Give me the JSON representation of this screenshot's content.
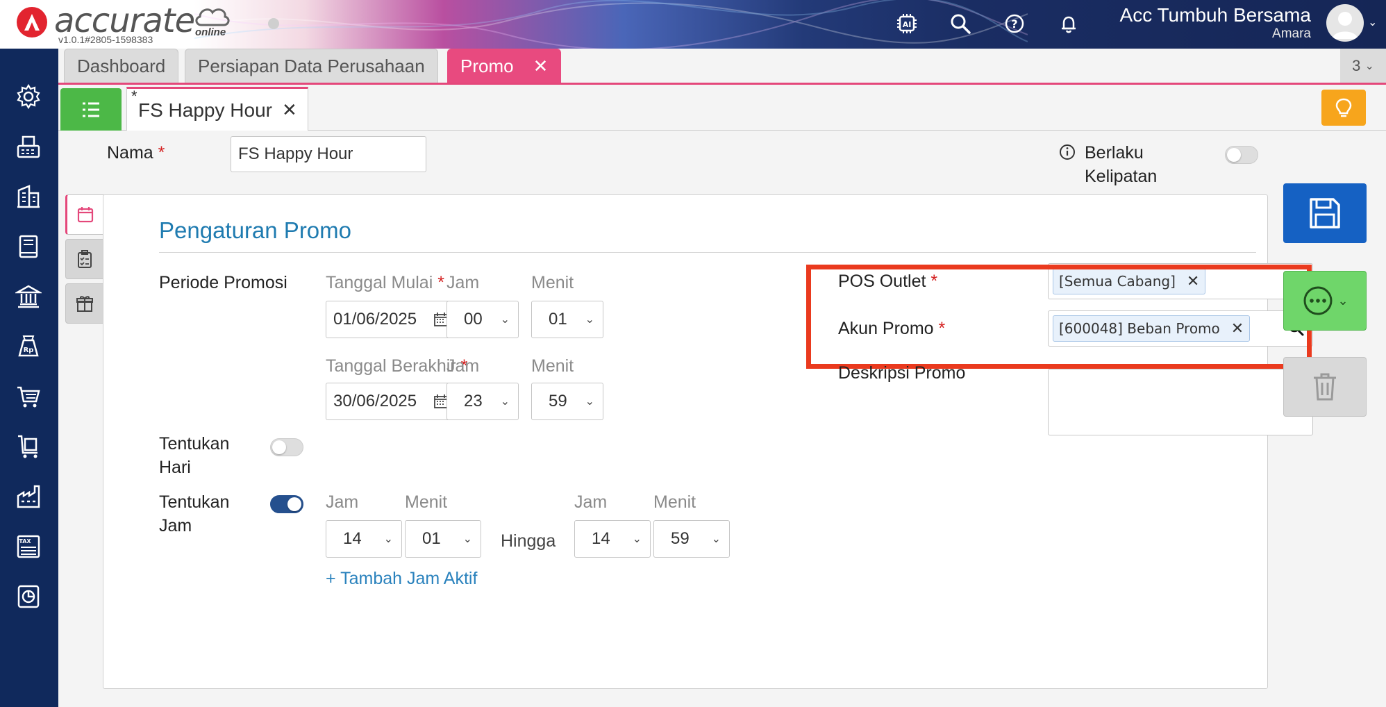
{
  "header": {
    "brand": "accurate",
    "brand_sub": "online",
    "version": "v1.0.1#2805-1598383",
    "company": "Acc Tumbuh Bersama",
    "user": "Amara"
  },
  "tabs": [
    {
      "label": "Dashboard"
    },
    {
      "label": "Persiapan Data Perusahaan"
    },
    {
      "label": "Promo"
    }
  ],
  "tab_count": "3",
  "doc_tab": {
    "modified": "*",
    "label": "FS Happy Hour"
  },
  "form": {
    "nama_label": "Nama",
    "nama_value": "FS Happy Hour",
    "kelipatan_label_1": "Berlaku",
    "kelipatan_label_2": "Kelipatan"
  },
  "panel": {
    "title": "Pengaturan Promo",
    "periode_label": "Periode Promosi",
    "tanggal_mulai_label": "Tanggal Mulai",
    "tanggal_mulai": "01/06/2025",
    "jam_label": "Jam",
    "menit_label": "Menit",
    "start_jam": "00",
    "start_menit": "01",
    "tanggal_berakhir_label": "Tanggal Berakhir",
    "tanggal_berakhir": "30/06/2025",
    "end_jam": "23",
    "end_menit": "59",
    "tentukan_hari_1": "Tentukan",
    "tentukan_hari_2": "Hari",
    "tentukan_jam_1": "Tentukan",
    "tentukan_jam_2": "Jam",
    "active_from_jam": "14",
    "active_from_menit": "01",
    "hingga": "Hingga",
    "active_to_jam": "14",
    "active_to_menit": "59",
    "add_active_hour": "+ Tambah Jam Aktif",
    "pos_outlet_label": "POS Outlet",
    "pos_outlet_tag": "[Semua Cabang]",
    "akun_promo_label": "Akun Promo",
    "akun_promo_tag": "[600048] Beban Promo",
    "deskripsi_label": "Deskripsi Promo"
  },
  "colors": {
    "accent_pink": "#e84a7f",
    "sidebar": "#10295c",
    "save_blue": "#1561c3",
    "more_green": "#6fd66a",
    "highlight_red": "#ea3a1e"
  }
}
